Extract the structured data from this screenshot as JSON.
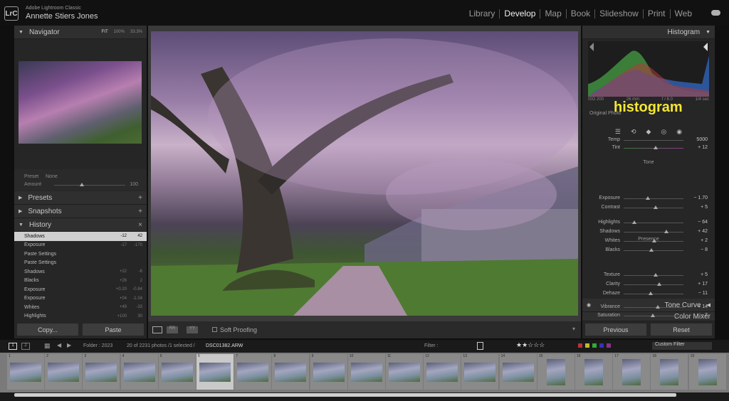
{
  "app": {
    "name": "Adobe Lightroom Classic",
    "user": "Annette Stiers Jones",
    "logo": "LrC"
  },
  "modules": [
    "Library",
    "Develop",
    "Map",
    "Book",
    "Slideshow",
    "Print",
    "Web"
  ],
  "active_module": "Develop",
  "navigator": {
    "title": "Navigator",
    "opts": [
      "FIT",
      "100%",
      "33.3%"
    ]
  },
  "preset": {
    "preset_label": "Preset",
    "preset_value": "None",
    "amount_label": "Amount",
    "amount_value": "100"
  },
  "panels": {
    "presets": "Presets",
    "snapshots": "Snapshots",
    "history": "History"
  },
  "history": [
    {
      "name": "Shadows",
      "a": "-12",
      "b": "42",
      "selected": true
    },
    {
      "name": "Exposure",
      "a": "-17",
      "b": "-170"
    },
    {
      "name": "Paste Settings",
      "a": "",
      "b": ""
    },
    {
      "name": "Paste Settings",
      "a": "",
      "b": ""
    },
    {
      "name": "Shadows",
      "a": "+22",
      "b": "-6"
    },
    {
      "name": "Blacks",
      "a": "+26",
      "b": "2"
    },
    {
      "name": "Exposure",
      "a": "+0.20",
      "b": "-0.84"
    },
    {
      "name": "Exposure",
      "a": "+04",
      "b": "-1.04"
    },
    {
      "name": "Whites",
      "a": "+49",
      "b": "-33"
    },
    {
      "name": "Highlights",
      "a": "+100",
      "b": "30"
    }
  ],
  "left_buttons": {
    "copy": "Copy...",
    "paste": "Paste"
  },
  "center_toolbar": {
    "soft_proofing": "Soft Proofing"
  },
  "histogram": {
    "title": "Histogram",
    "iso": "ISO 200",
    "focal": "26 mm",
    "aperture": "f / 8.0",
    "shutter": "1/4 sec",
    "original": "Original Photo",
    "annotation": "histogram"
  },
  "basic": {
    "temp_label": "Temp",
    "temp_value": "5000",
    "tint_label": "Tint",
    "tint_value": "+ 12",
    "tone_section": "Tone",
    "presence_section": "Presence",
    "sliders": [
      {
        "label": "Exposure",
        "value": "− 1.70",
        "level": 0.41
      },
      {
        "label": "Contrast",
        "value": "+ 5",
        "level": 0.53
      },
      {
        "label": "Highlights",
        "value": "− 64",
        "level": 0.18
      },
      {
        "label": "Shadows",
        "value": "+ 42",
        "level": 0.71
      },
      {
        "label": "Whites",
        "value": "+ 2",
        "level": 0.51
      },
      {
        "label": "Blacks",
        "value": "− 8",
        "level": 0.46
      },
      {
        "label": "Texture",
        "value": "+ 5",
        "level": 0.53
      },
      {
        "label": "Clarity",
        "value": "+ 17",
        "level": 0.59
      },
      {
        "label": "Dehaze",
        "value": "− 11",
        "level": 0.45
      },
      {
        "label": "Vibrance",
        "value": "+ 14",
        "level": 0.57
      },
      {
        "label": "Saturation",
        "value": "− 2",
        "level": 0.49
      }
    ]
  },
  "right_panels": {
    "tone_curve": "Tone Curve",
    "color_mixer": "Color Mixer"
  },
  "right_buttons": {
    "previous": "Previous",
    "reset": "Reset"
  },
  "filmbar": {
    "folder": "Folder : 2023",
    "count": "20 of 2231 photos /1 selected /",
    "file": "DSC01382.ARW",
    "filter_label": "Filter :",
    "custom_filter": "Custom Filter",
    "pages": [
      "1",
      "2"
    ]
  },
  "filmstrip": {
    "numbers": [
      "1",
      "2",
      "3",
      "4",
      "5",
      "6",
      "7",
      "8",
      "9",
      "10",
      "11",
      "12",
      "13",
      "14",
      "15",
      "16",
      "17",
      "18",
      "19"
    ],
    "selected_index": 5
  },
  "colors": {
    "accent_yellow": "#f5e732",
    "panel": "#262626"
  }
}
